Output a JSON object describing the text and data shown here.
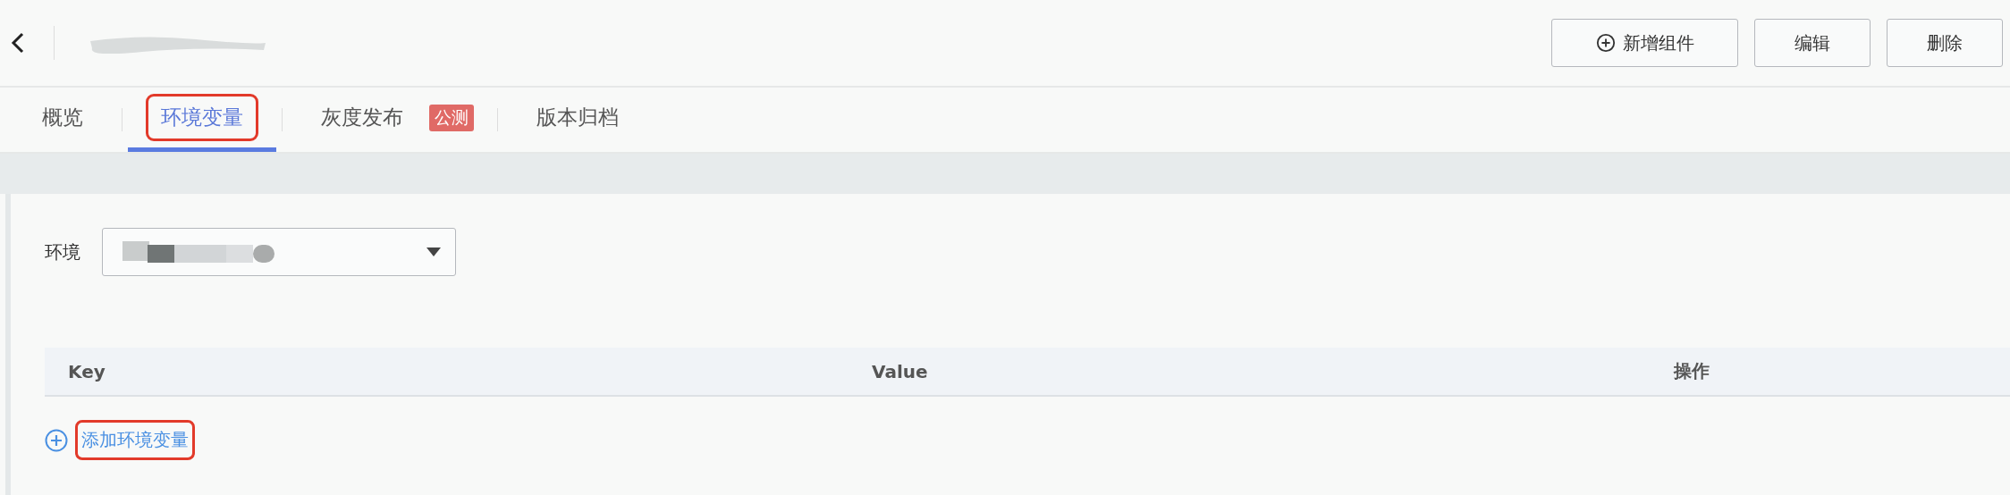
{
  "header": {
    "title_redacted": true,
    "buttons": [
      {
        "label": "新增组件",
        "kind": "add"
      },
      {
        "label": "编辑",
        "kind": "plain"
      },
      {
        "label": "删除",
        "kind": "plain"
      }
    ]
  },
  "tabs": [
    {
      "label": "概览",
      "selected": false,
      "highlighted": false
    },
    {
      "label": "环境变量",
      "selected": true,
      "highlighted": true
    },
    {
      "label": "灰度发布",
      "selected": false,
      "highlighted": false,
      "badge": "公测"
    },
    {
      "label": "版本归档",
      "selected": false,
      "highlighted": false
    }
  ],
  "environment": {
    "label": "环境",
    "value_redacted": true
  },
  "table": {
    "columns": [
      "Key",
      "Value",
      "操作"
    ]
  },
  "add_link": {
    "label": "添加环境变量",
    "highlighted": true
  }
}
